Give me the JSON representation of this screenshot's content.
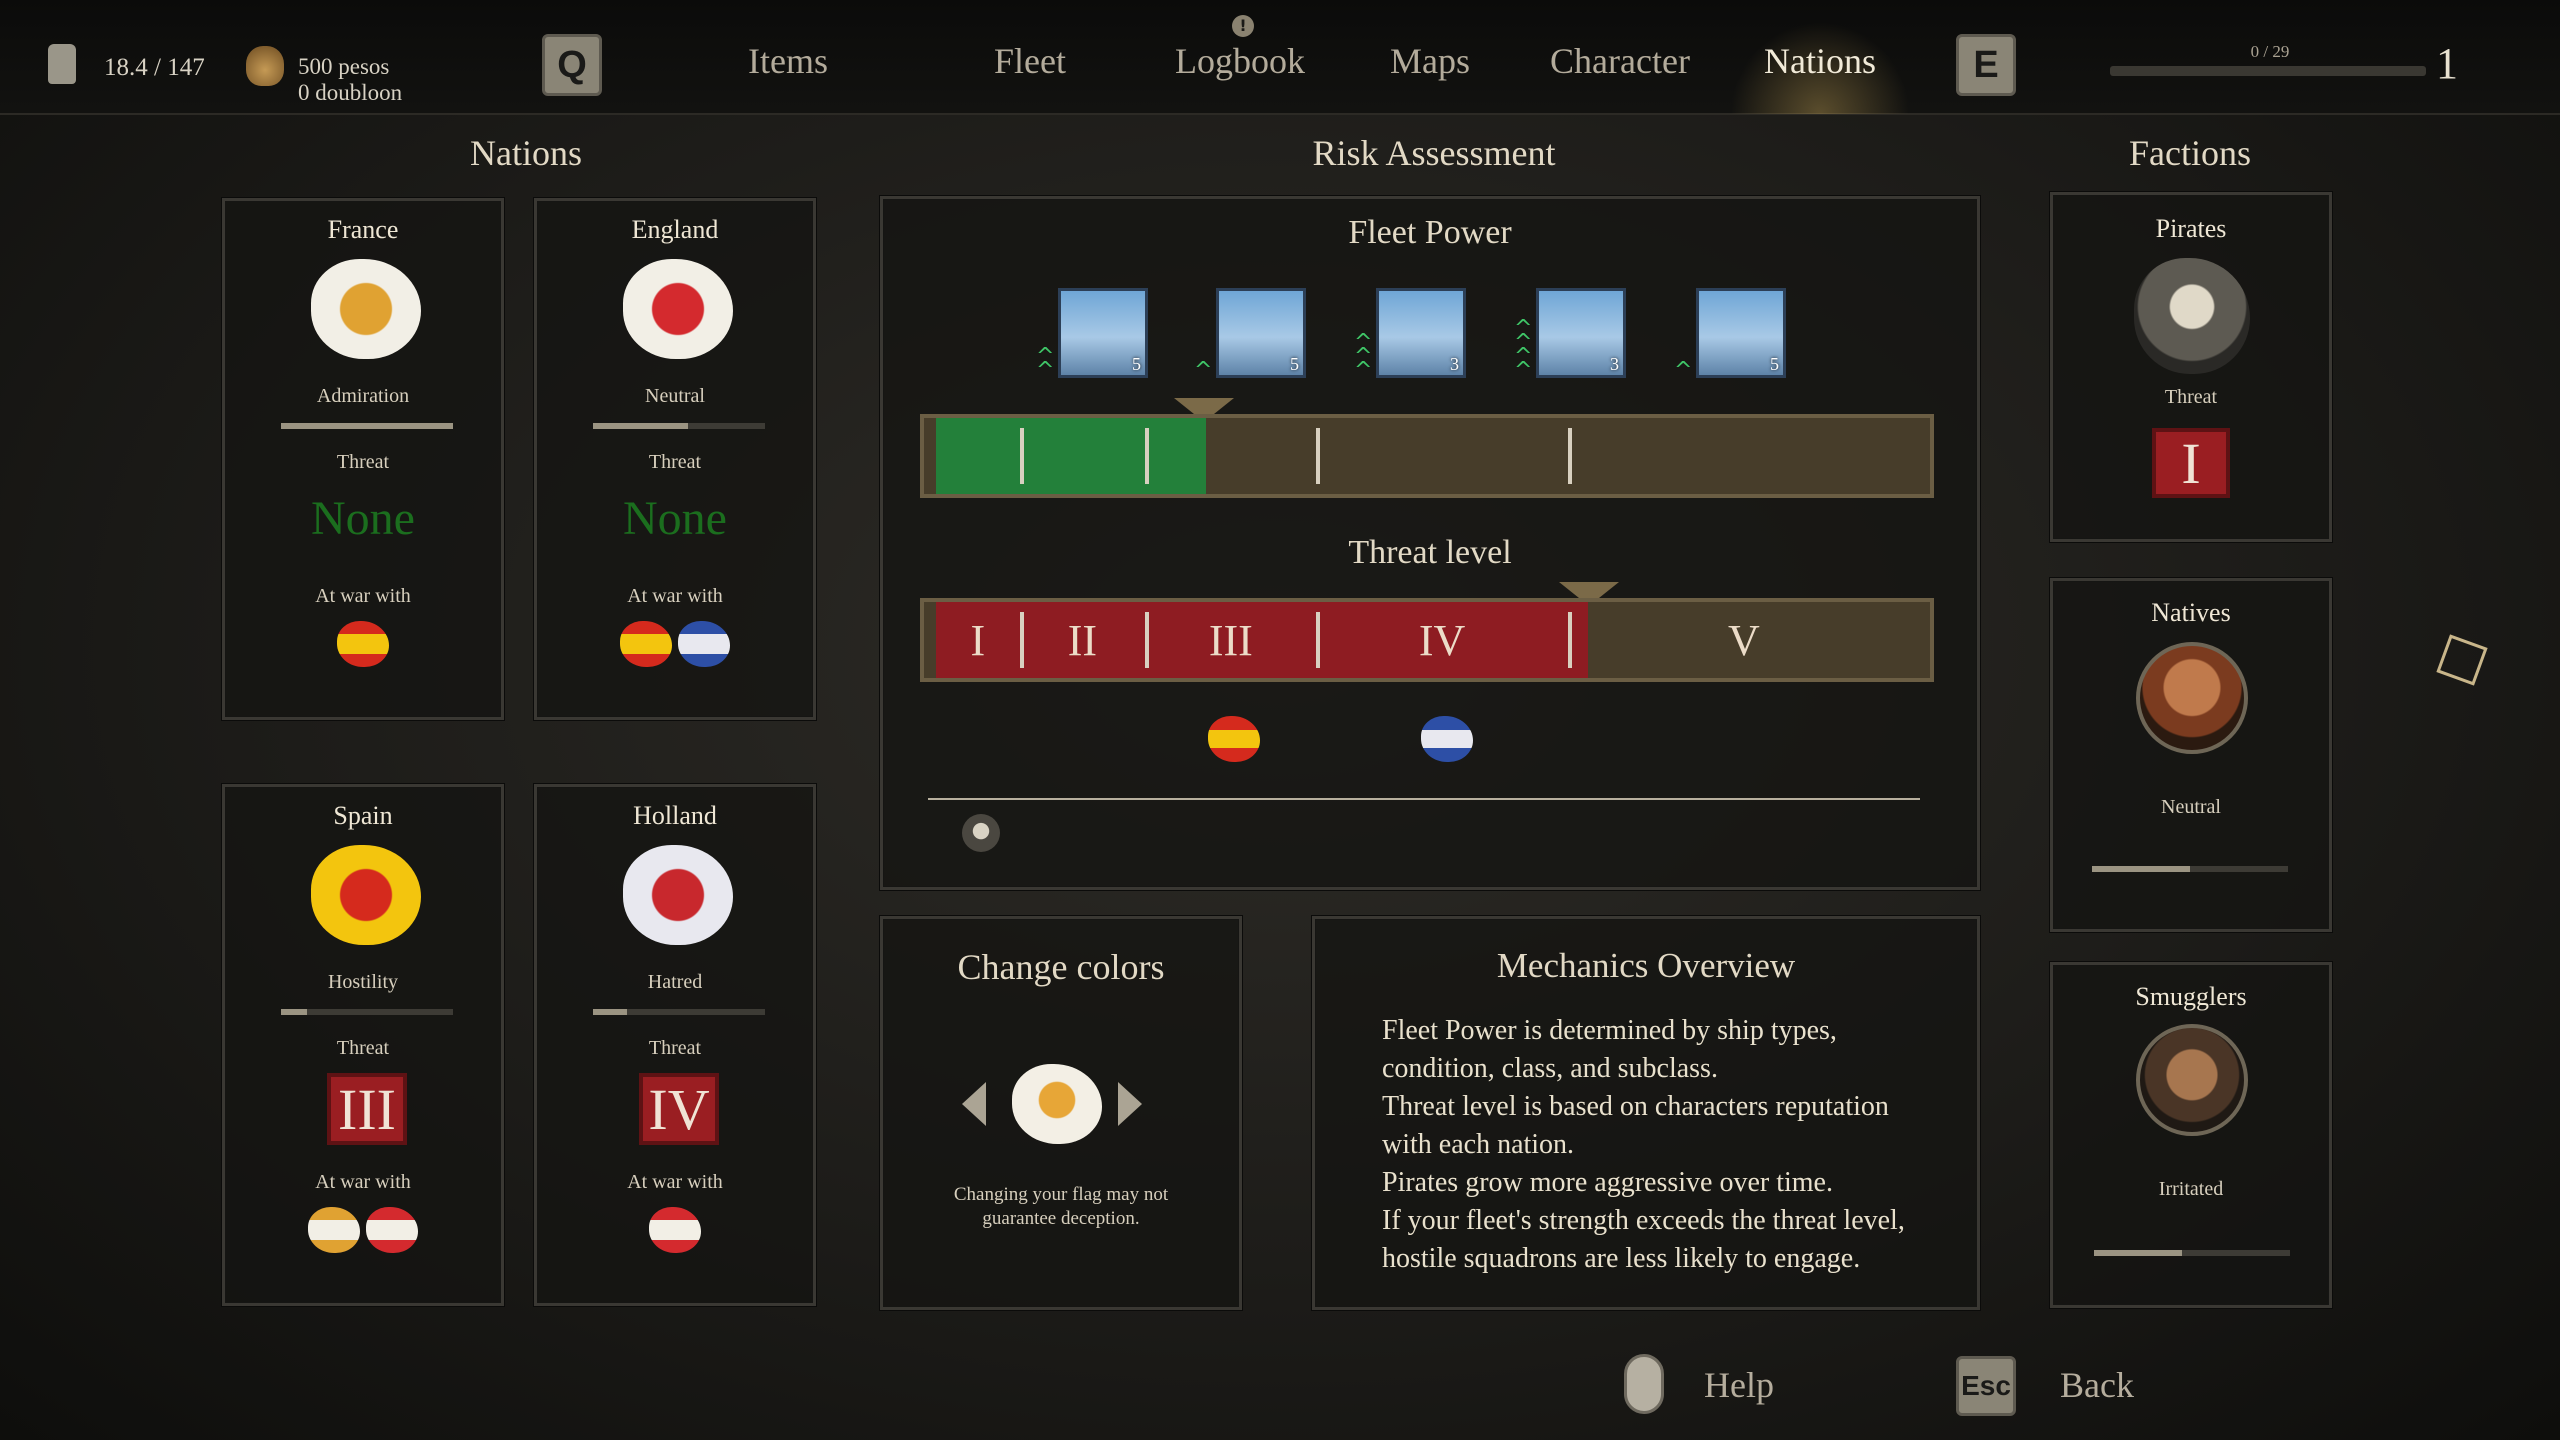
{
  "top_bar": {
    "weight": "18.4 / 147",
    "money_pesos": "500 pesos",
    "money_doubloon": "0 doubloon",
    "key_left": "Q",
    "key_right": "E",
    "tabs": [
      "Items",
      "Fleet",
      "Logbook",
      "Maps",
      "Character",
      "Nations"
    ],
    "active_tab": "Nations",
    "xp_text": "0 / 29",
    "level": "1",
    "xp_progress": 0.0
  },
  "nations": {
    "title": "Nations",
    "cards": [
      {
        "name": "France",
        "status": "Admiration",
        "threat_label": "Threat",
        "threat": "None",
        "war_label": "At war with",
        "flag_colors": [
          "#f2efe6",
          "#e0a232"
        ],
        "war_flags": [
          [
            "#f3c50e",
            "#d52a1d"
          ]
        ],
        "rep": 1.0
      },
      {
        "name": "England",
        "status": "Neutral",
        "threat_label": "Threat",
        "threat": "None",
        "war_label": "At war with",
        "flag_colors": [
          "#f2efe6",
          "#d42a2e"
        ],
        "war_flags": [
          [
            "#f3c50e",
            "#d52a1d"
          ],
          [
            "#e8e8ef",
            "#2d4fa6"
          ]
        ],
        "rep": 0.55
      },
      {
        "name": "Spain",
        "status": "Hostility",
        "threat_label": "Threat",
        "threat": "III",
        "war_label": "At war with",
        "flag_colors": [
          "#f3c50e",
          "#d52a1d"
        ],
        "war_flags": [
          [
            "#f2efe6",
            "#e0a232"
          ],
          [
            "#f2efe6",
            "#d42a2e"
          ]
        ],
        "rep": 0.15
      },
      {
        "name": "Holland",
        "status": "Hatred",
        "threat_label": "Threat",
        "threat": "IV",
        "war_label": "At war with",
        "flag_colors": [
          "#e8e8ef",
          "#c8282d"
        ],
        "war_flags": [
          [
            "#f2efe6",
            "#d42a2e"
          ]
        ],
        "rep": 0.2
      }
    ]
  },
  "risk": {
    "title": "Risk Assessment",
    "fleet_power_title": "Fleet Power",
    "ships": [
      {
        "class": "5",
        "upgrades": 2
      },
      {
        "class": "5",
        "upgrades": 1
      },
      {
        "class": "3",
        "upgrades": 3
      },
      {
        "class": "3",
        "upgrades": 4
      },
      {
        "class": "5",
        "upgrades": 1
      }
    ],
    "fleet_power_value": 0.28,
    "threat_level_title": "Threat level",
    "threat_levels": [
      "I",
      "II",
      "III",
      "IV",
      "V"
    ],
    "threat_current": 0.66,
    "threat_flags": [
      [
        "#f3c50e",
        "#d52a1d"
      ],
      [
        "#e8e8ef",
        "#2d4fa6"
      ]
    ]
  },
  "change_colors": {
    "title": "Change colors",
    "note_line1": "Changing your flag may not",
    "note_line2": "guarantee deception."
  },
  "mechanics": {
    "title": "Mechanics Overview",
    "lines": [
      "Fleet Power is determined by ship types,",
      "condition, class, and subclass.",
      "Threat level is based on characters reputation",
      "with each nation.",
      "Pirates grow more aggressive over time.",
      "If your fleet's strength exceeds the threat level,",
      "hostile squadrons are less likely to engage."
    ]
  },
  "factions": {
    "title": "Factions",
    "pirates": {
      "name": "Pirates",
      "threat_label": "Threat",
      "threat": "I"
    },
    "natives": {
      "name": "Natives",
      "status": "Neutral",
      "rep": 0.5
    },
    "smugglers": {
      "name": "Smugglers",
      "status": "Irritated",
      "rep": 0.45
    }
  },
  "footer": {
    "help_label": "Help",
    "help_key": "mouse-icon",
    "back_label": "Back",
    "back_key": "Esc"
  }
}
